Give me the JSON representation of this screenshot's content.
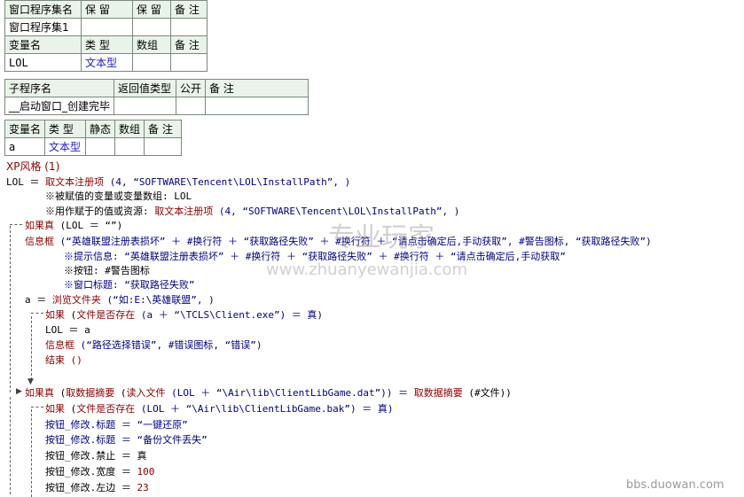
{
  "window_table": {
    "headers": [
      "窗口程序集名",
      "保 留",
      "保 留",
      "备 注"
    ],
    "row": [
      "窗口程序集1",
      "",
      "",
      ""
    ],
    "var_headers": [
      "变量名",
      "类 型",
      "数组",
      "备 注"
    ],
    "var_row": [
      "LOL",
      "文本型",
      "",
      ""
    ]
  },
  "sub_table": {
    "headers": [
      "子程序名",
      "返回值类型",
      "公开",
      "备 注"
    ],
    "row": [
      "__启动窗口_创建完毕",
      "",
      "",
      ""
    ]
  },
  "local_table": {
    "headers": [
      "变量名",
      "类 型",
      "静态",
      "数组",
      "备 注"
    ],
    "row": [
      "a",
      "文本型",
      "",
      "",
      ""
    ]
  },
  "code": {
    "l1": "XP风格 (1)",
    "l2_a": "LOL ＝ ",
    "l2_b": "取文本注册项",
    "l2_c": " (4, “SOFTWARE\\Tencent\\LOL\\InstallPath”, )",
    "l3": "※被赋值的变量或变量数组: LOL",
    "l4_a": "※用作赋于的值或资源: ",
    "l4_b": "取文本注册项",
    "l4_c": " (4, “SOFTWARE\\Tencent\\LOL\\InstallPath”, )",
    "l5_a": "如果真",
    "l5_b": " (LOL ＝ “”)",
    "l6_a": "信息框",
    "l6_b": " (“英雄联盟注册表损坏” ＋ #换行符 ＋ “获取路径失败” ＋ #换行符 ＋ “请点击确定后,手动获取”, #警告图标, “获取路径失败”)",
    "l7": "※提示信息: “英雄联盟注册表损坏” ＋ #换行符 ＋ “获取路径失败” ＋ #换行符 ＋ “请点击确定后,手动获取”",
    "l8": "※按钮: #警告图标",
    "l9": "※窗口标题: “获取路径失败”",
    "l10_a": "a ＝ ",
    "l10_b": "浏览文件夹",
    "l10_c": " (“如:E:\\英雄联盟”, )",
    "l11_a": "如果",
    "l11_b": " (",
    "l11_c": "文件是否存在",
    "l11_d": " (a ＋ “\\TCLS\\Client.exe”) ＝ 真)",
    "l12": "LOL ＝ a",
    "l13_a": "信息框",
    "l13_b": " (“路径选择错误”, #错误图标, “错误”)",
    "l14": "结束 ()",
    "l15_a": "如果真",
    "l15_b": " (",
    "l15_c": "取数据摘要",
    "l15_d": " (",
    "l15_e": "读入文件",
    "l15_f": " (LOL ＋ “\\Air\\lib\\ClientLibGame.dat”)) ＝ ",
    "l15_g": "取数据摘要",
    "l15_h": " (#文件))",
    "l16_a": "如果",
    "l16_b": " (",
    "l16_c": "文件是否存在",
    "l16_d": " (LOL ＋ “\\Air\\lib\\ClientLibGame.bak”) ＝ 真)",
    "l17": "按钮_修改.标题 ＝ “一键还原”",
    "l18": "按钮_修改.标题 ＝ “备份文件丢失”",
    "l19": "按钮_修改.禁止 ＝ 真",
    "l20_a": "按钮_修改.宽度 ＝ ",
    "l20_b": "100",
    "l21_a": "按钮_修改.左边 ＝ ",
    "l21_b": "23"
  },
  "watermark": {
    "logo_text": "专业玩家",
    "url": "www.zhuanyewanjia.com",
    "corner": "bbs.duowan.com"
  }
}
